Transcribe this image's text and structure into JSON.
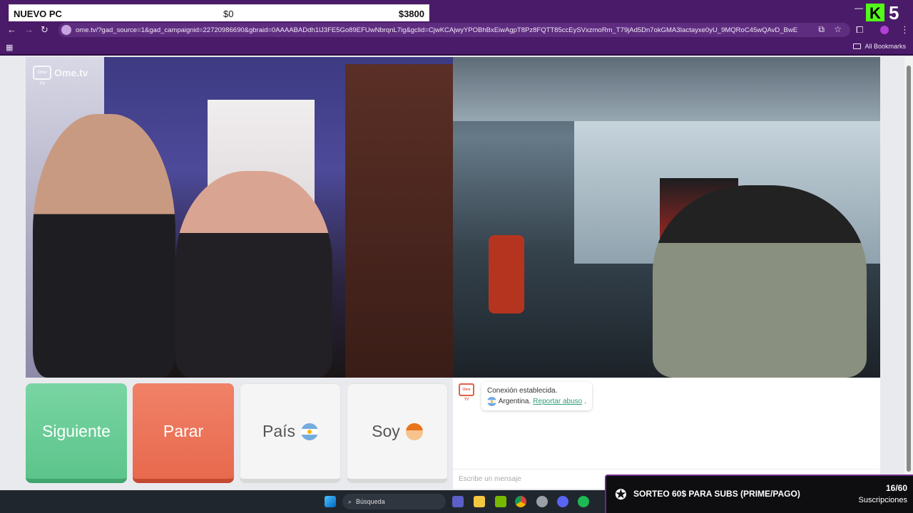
{
  "stream_overlay": {
    "goal_title": "NUEVO PC",
    "current_amount": "$0",
    "goal_amount": "$3800",
    "brand_letter": "K",
    "brand_number": "5"
  },
  "browser": {
    "url": "ome.tv/?gad_source=1&gad_campaignid=22720986690&gbraid=0AAAABADdh1lJ3FE5Go89EFUwNbrqnL7ig&gclid=CjwKCAjwyYPOBhBxEiwAgpT8Pz8FQTT85ccEySVxzmoRm_T79jAd5Dn7okGMA3Iactayxe0yU_9MQRoC45wQAvD_BwE",
    "bookmarks_label": "All Bookmarks"
  },
  "video": {
    "watermark": "Ome.tv",
    "watermark_box": "Ome TV"
  },
  "controls": {
    "next_label": "Siguiente",
    "stop_label": "Parar",
    "country_label": "País",
    "gender_label": "Soy"
  },
  "chat": {
    "logo_text": "Ome TV",
    "connection_text": "Conexión establecida.",
    "country": "Argentina.",
    "report_link": "Reportar abuso",
    "report_suffix": ".",
    "input_placeholder": "Escribe un mensaje"
  },
  "taskbar": {
    "search_label": "Búsqueda"
  },
  "subs_overlay": {
    "title": "SORTEO 60$ PARA SUBS (PRIME/PAGO)",
    "count": "16/60",
    "label": "Suscripciones"
  },
  "colors": {
    "browser_purple": "#4a1b68",
    "next_green": "#5cc48b",
    "stop_red": "#e8694e",
    "link_green": "#2f9f7a",
    "kick_green": "#53fc18"
  }
}
